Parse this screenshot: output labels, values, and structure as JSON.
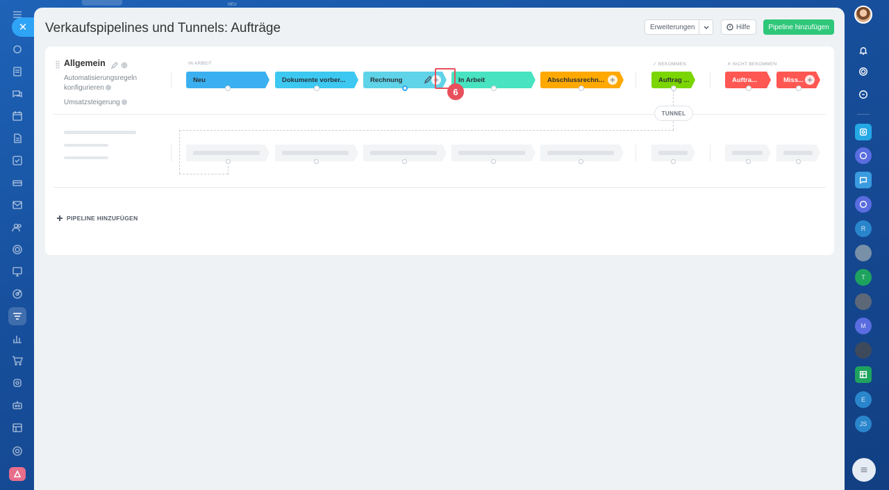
{
  "top": {
    "neu_label": "NEU"
  },
  "header": {
    "title": "Verkaufspipelines und Tunnels: Aufträge",
    "extensions_label": "Erweiterungen",
    "help_label": "Hilfe",
    "add_pipeline_label": "Pipeline hinzufügen"
  },
  "pipeline": {
    "name": "Allgemein",
    "links": [
      "Automatisierungsregeln konfigurieren",
      "Umsatzsteigerung"
    ],
    "groups": {
      "in_work": "IN ARBEIT",
      "received": "BEKOMMEN",
      "not_received": "NICHT BEKOMMEN"
    },
    "stages": [
      {
        "label": "Neu",
        "color": "#3bb0f0"
      },
      {
        "label": "Dokumente vorber...",
        "color": "#3cc8f0"
      },
      {
        "label": "Rechnung",
        "color": "#5fd3e8"
      },
      {
        "label": "In Arbeit",
        "color": "#48e3c0"
      },
      {
        "label": "Abschlussrechn...",
        "color": "#ffa900"
      },
      {
        "label": "Auftrag ...",
        "color": "#7bd500"
      },
      {
        "label": "Auftra...",
        "color": "#ff5752"
      },
      {
        "label": "Miss...",
        "color": "#ff5752"
      }
    ],
    "tunnel_label": "TUNNEL",
    "step_badge": "6"
  },
  "footer": {
    "add_pipeline_label": "PIPELINE HINZUFÜGEN"
  },
  "right_rail": {
    "letters": [
      "R",
      "T",
      "M",
      "E",
      "JS"
    ]
  }
}
